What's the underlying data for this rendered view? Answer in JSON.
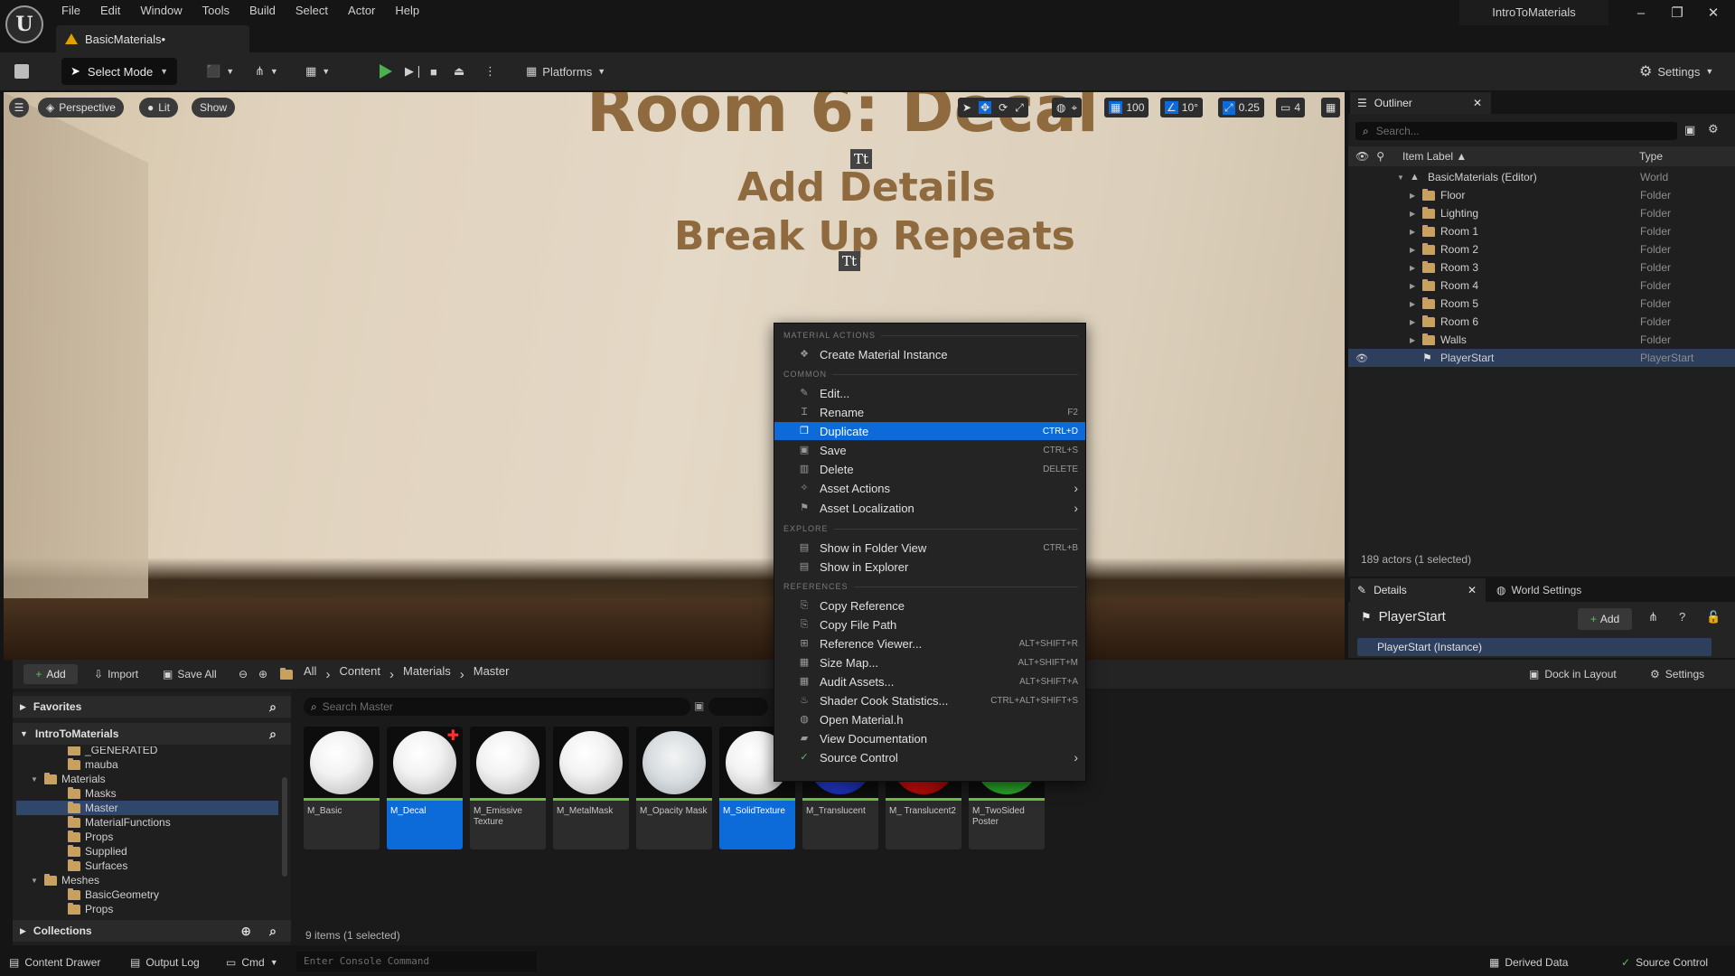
{
  "menu": [
    "File",
    "Edit",
    "Window",
    "Tools",
    "Build",
    "Select",
    "Actor",
    "Help"
  ],
  "doc_tab": "BasicMaterials•",
  "project_name": "IntroToMaterials",
  "toolbar": {
    "select_mode": "Select Mode",
    "platforms": "Platforms",
    "settings": "Settings"
  },
  "viewport": {
    "perspective": "Perspective",
    "lit": "Lit",
    "show": "Show",
    "title_line1": "Room 6: Decal",
    "title_line2": "Add Details",
    "title_line3": "Break Up Repeats",
    "tt_glyph": "Tt",
    "grid": "100",
    "angle": "10°",
    "scale": "0.25",
    "camera": "4"
  },
  "outliner": {
    "tab": "Outliner",
    "search_placeholder": "Search...",
    "col_label": "Item Label ▲",
    "col_type": "Type",
    "rows": [
      {
        "label": "BasicMaterials (Editor)",
        "type": "World"
      },
      {
        "label": "Floor",
        "type": "Folder"
      },
      {
        "label": "Lighting",
        "type": "Folder"
      },
      {
        "label": "Room 1",
        "type": "Folder"
      },
      {
        "label": "Room 2",
        "type": "Folder"
      },
      {
        "label": "Room 3",
        "type": "Folder"
      },
      {
        "label": "Room 4",
        "type": "Folder"
      },
      {
        "label": "Room 5",
        "type": "Folder"
      },
      {
        "label": "Room 6",
        "type": "Folder"
      },
      {
        "label": "Walls",
        "type": "Folder"
      },
      {
        "label": "PlayerStart",
        "type": "PlayerStart"
      }
    ],
    "actor_count": "189 actors (1 selected)"
  },
  "details": {
    "tab": "Details",
    "world_settings_tab": "World Settings",
    "title": "PlayerStart",
    "add": "Add",
    "instance": "PlayerStart (Instance)"
  },
  "content_browser": {
    "add": "Add",
    "import": "Import",
    "save_all": "Save All",
    "breadcrumbs": [
      "All",
      "Content",
      "Materials",
      "Master"
    ],
    "dock_in_layout": "Dock in Layout",
    "settings": "Settings",
    "favorites": "Favorites",
    "project": "IntroToMaterials",
    "collections": "Collections",
    "tree": [
      {
        "label": "_GENERATED",
        "depth": 3
      },
      {
        "label": "mauba",
        "depth": 3
      },
      {
        "label": "Materials",
        "depth": 2,
        "open": true
      },
      {
        "label": "Masks",
        "depth": 3
      },
      {
        "label": "Master",
        "depth": 3,
        "selected": true
      },
      {
        "label": "MaterialFunctions",
        "depth": 3
      },
      {
        "label": "Props",
        "depth": 3
      },
      {
        "label": "Supplied",
        "depth": 3
      },
      {
        "label": "Surfaces",
        "depth": 3
      },
      {
        "label": "Meshes",
        "depth": 2,
        "open": true
      },
      {
        "label": "BasicGeometry",
        "depth": 3
      },
      {
        "label": "Props",
        "depth": 3
      }
    ],
    "search_placeholder": "Search Master",
    "assets": [
      {
        "name": "M_Basic",
        "color": "white"
      },
      {
        "name": "M_Decal",
        "color": "white",
        "selected": true,
        "badge": true
      },
      {
        "name": "M_Emissive Texture",
        "color": "white"
      },
      {
        "name": "M_MetalMask",
        "color": "white"
      },
      {
        "name": "M_Opacity Mask",
        "color": "glass"
      },
      {
        "name": "M_SolidTexture",
        "color": "white",
        "selected": true
      },
      {
        "name": "M_Translucent",
        "color": "blue"
      },
      {
        "name": "M_ Translucent2",
        "color": "red"
      },
      {
        "name": "M_TwoSided Poster",
        "color": "multi"
      }
    ],
    "item_count": "9 items (1 selected)"
  },
  "status_bar": {
    "content_drawer": "Content Drawer",
    "output_log": "Output Log",
    "cmd": "Cmd",
    "console_placeholder": "Enter Console Command",
    "derived_data": "Derived Data",
    "source_control": "Source Control"
  },
  "context_menu": {
    "sections": [
      {
        "title": "MATERIAL ACTIONS",
        "items": [
          {
            "label": "Create Material Instance",
            "icon": "material-instance-icon",
            "glyph": "❖"
          }
        ]
      },
      {
        "title": "COMMON",
        "items": [
          {
            "label": "Edit...",
            "icon": "pencil-icon",
            "glyph": "✎"
          },
          {
            "label": "Rename",
            "icon": "rename-icon",
            "glyph": "Ɪ",
            "shortcut": "F2"
          },
          {
            "label": "Duplicate",
            "icon": "duplicate-icon",
            "glyph": "❐",
            "shortcut": "CTRL+D",
            "highlighted": true
          },
          {
            "label": "Save",
            "icon": "save-icon",
            "glyph": "▣",
            "shortcut": "CTRL+S"
          },
          {
            "label": "Delete",
            "icon": "trash-icon",
            "glyph": "▥",
            "shortcut": "DELETE"
          },
          {
            "label": "Asset Actions",
            "icon": "wrench-icon",
            "glyph": "✧",
            "submenu": true
          },
          {
            "label": "Asset Localization",
            "icon": "flag-icon",
            "glyph": "⚑",
            "submenu": true
          }
        ]
      },
      {
        "title": "EXPLORE",
        "items": [
          {
            "label": "Show in Folder View",
            "icon": "folder-view-icon",
            "glyph": "▤",
            "shortcut": "CTRL+B"
          },
          {
            "label": "Show in Explorer",
            "icon": "explorer-icon",
            "glyph": "▤"
          }
        ]
      },
      {
        "title": "REFERENCES",
        "items": [
          {
            "label": "Copy Reference",
            "icon": "copy-reference-icon",
            "glyph": "⎘"
          },
          {
            "label": "Copy File Path",
            "icon": "copy-path-icon",
            "glyph": "⎘"
          },
          {
            "label": "Reference Viewer...",
            "icon": "reference-viewer-icon",
            "glyph": "⊞",
            "shortcut": "ALT+SHIFT+R"
          },
          {
            "label": "Size Map...",
            "icon": "size-map-icon",
            "glyph": "▦",
            "shortcut": "ALT+SHIFT+M"
          },
          {
            "label": "Audit Assets...",
            "icon": "audit-icon",
            "glyph": "▦",
            "shortcut": "ALT+SHIFT+A"
          },
          {
            "label": "Shader Cook Statistics...",
            "icon": "shader-stats-icon",
            "glyph": "♨",
            "shortcut": "CTRL+ALT+SHIFT+S"
          },
          {
            "label": "Open Material.h",
            "icon": "code-icon",
            "glyph": "◍"
          },
          {
            "label": "View Documentation",
            "icon": "book-icon",
            "glyph": "▰"
          },
          {
            "label": "Source Control",
            "icon": "source-control-icon",
            "glyph": "✓",
            "submenu": true
          }
        ]
      }
    ]
  }
}
